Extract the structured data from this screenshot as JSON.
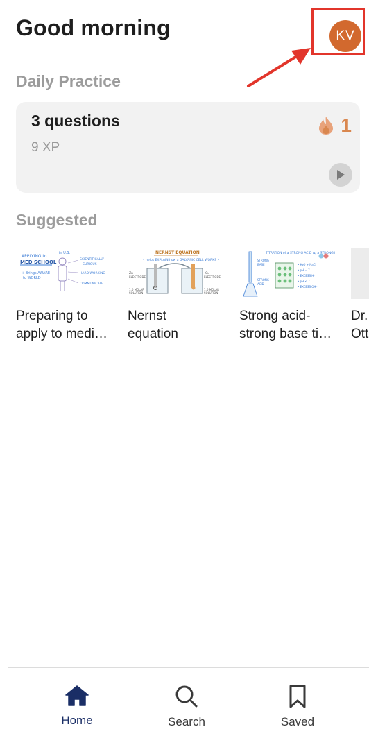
{
  "header": {
    "greeting": "Good morning",
    "avatar_initials": "KV",
    "avatar_color": "#d2692e",
    "highlight_color": "#e2352b"
  },
  "daily_practice": {
    "section_title": "Daily Practice",
    "card_title": "3 questions",
    "xp": "9 XP",
    "streak_count": "1",
    "streak_icon": "flame-icon",
    "play_icon": "play-icon"
  },
  "suggested": {
    "section_title": "Suggested",
    "items": [
      {
        "line1": "Preparing to",
        "line2": "apply to medi…",
        "thumb": "applying-med-school-sketch"
      },
      {
        "line1": "Nernst",
        "line2": "equation",
        "thumb": "nernst-equation-sketch"
      },
      {
        "line1": "Strong acid-",
        "line2": "strong base ti…",
        "thumb": "titration-sketch"
      },
      {
        "line1": "Dr.",
        "line2": "Ott",
        "thumb": "partial-thumbnail"
      }
    ]
  },
  "tabbar": {
    "home": "Home",
    "search": "Search",
    "saved": "Saved",
    "active_color": "#1a2e66"
  }
}
